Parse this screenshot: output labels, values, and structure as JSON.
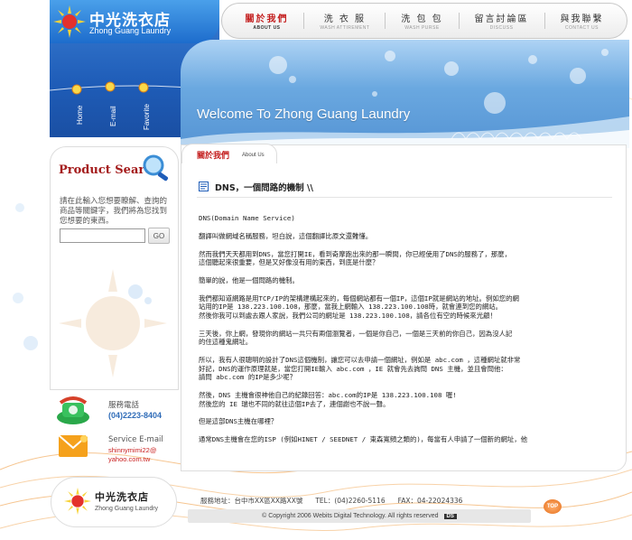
{
  "brand": {
    "name_zh": "中光洗衣店",
    "name_en": "Zhong Guang Laundry"
  },
  "side_nav": [
    {
      "label": "Home"
    },
    {
      "label": "E-mail"
    },
    {
      "label": "Favorite"
    }
  ],
  "top_nav": [
    {
      "zh": "關於我們",
      "en": "ABOUT US",
      "active": true
    },
    {
      "zh": "洗 衣 服",
      "en": "WASH ATTIREMENT",
      "active": false
    },
    {
      "zh": "洗 包 包",
      "en": "WASH PURSE",
      "active": false
    },
    {
      "zh": "留言討論區",
      "en": "DISCUSS",
      "active": false
    },
    {
      "zh": "與我聯繫",
      "en": "CONTACT US",
      "active": false
    }
  ],
  "banner": {
    "title": "Welcome To Zhong Guang Laundry"
  },
  "search": {
    "title": "Product Search",
    "description": "請在此輸入您想要瞭解、查詢的商品等關鍵字，我們將為您找到您想要的東西。",
    "input_value": "",
    "input_placeholder": "",
    "go_label": "GO"
  },
  "contact": {
    "phone_label": "服務電話",
    "phone_value": "(04)2223-8404",
    "email_label": "Service E-mail",
    "email_line1": "shinnymimi22@",
    "email_line2": "yahoo.com.tw"
  },
  "content": {
    "tab_zh": "關於我們",
    "tab_en": "About Us",
    "article_title": "DNS，一個問路的機制 \\\\",
    "paragraphs": [
      "DNS(Domain Name Service)",
      "翻譯叫做網域名稱服務，坦白說，這個翻譯比原文還難懂。",
      "然而我們天天都用到DNS，當您打開IE，看到奇摩跑出來的那一瞬間，你已經使用了DNS的服務了，那麼，\n這個聽起來很重要，但是又好像沒有用的東西，到底是什麼？",
      "簡單的說，他是一個問路的機制。",
      "我們都知道網路是用TCP/IP的架構建構起來的，每個網站都有一個IP，這個IP就是網站的地址。例如您的網\n站用的IP是 138.223.100.108，那麼，當我上網輸入 138.223.100.108時，就會連到您的網站。\n然後你我可以到處去跟人家說，我們公司的網址是 138.223.100.108，請各位有空的時候來光顧！",
      "三天後，你上網，發現你的網站一共只有兩個瀏覽者，一個是你自己，一個是三天前的你自己，因為沒人記\n的住這種鬼網址。",
      "所以，我有人很聰明的設計了DNS這個機制，讓您可以去申請一個網址，例如是 abc.com ，這種網址就非常\n好記，DNS的運作原理就是，當您打開IE輸入 abc.com ，IE 就會先去詢問 DNS 主機，並且會問他：\n請問 abc.com 的IP是多少呢？",
      "然後，DNS 主機會很神他自己的紀錄回答：abc.com的IP是 138.223.100.108 喔!\n然後您的 IE 瑞也不同的就往這個IP去了，連個謝也不說一聲。",
      "但是這部DNS主機在哪裡？",
      "通常DNS主機會在您的ISP (例如HINET / SEEDNET / 東森寬頻之類的)，每當有人申請了一個新的網址，他"
    ]
  },
  "footer": {
    "address": "服務地址：台中市XX區XX路XX號",
    "tel": "TEL：(04)2260-5116",
    "fax": "FAX：04-22024336",
    "copyright": "© Copyright 2006 Webits Digital Technology. All rights reserved",
    "badge": "DS",
    "top_label": "TOP"
  },
  "colors": {
    "brand_blue": "#1f5db8",
    "accent_red": "#c31d1d",
    "link_blue": "#2f6cb8"
  }
}
